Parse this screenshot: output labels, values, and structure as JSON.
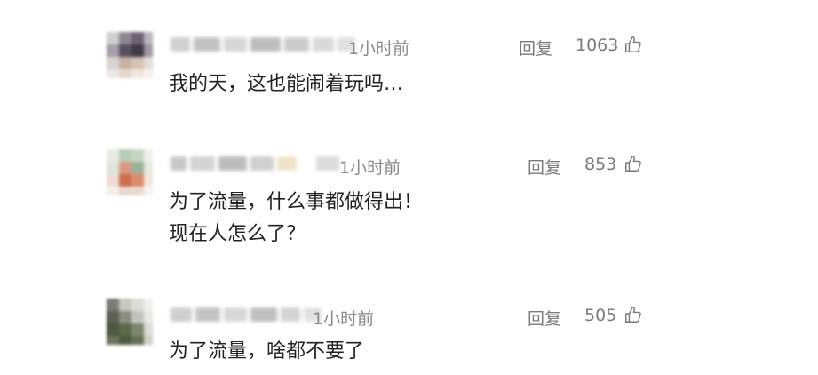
{
  "comments": [
    {
      "time": "1小时前",
      "reply_label": "回复",
      "likes": "1063",
      "lines": [
        "我的天，这也能闹着玩吗…"
      ]
    },
    {
      "time": "1小时前",
      "reply_label": "回复",
      "likes": "853",
      "lines": [
        "为了流量，什么事都做得出！",
        "现在人怎么了？"
      ]
    },
    {
      "time": "1小时前",
      "reply_label": "回复",
      "likes": "505",
      "lines": [
        "为了流量，啥都不要了"
      ]
    }
  ],
  "colors": {
    "text": "#222222",
    "meta": "#8a8a8a",
    "action": "#7a7a7a"
  },
  "icons": {
    "like": "thumbs-up-icon",
    "avatar": "blurred-avatar"
  }
}
